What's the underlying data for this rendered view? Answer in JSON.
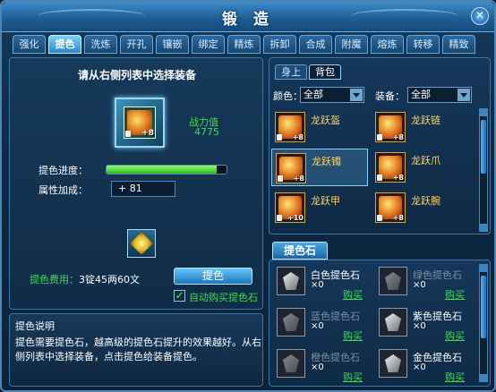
{
  "window": {
    "title": "锻 造",
    "close_icon": "close-icon"
  },
  "tabs": [
    "强化",
    "提色",
    "洗炼",
    "开孔",
    "镶嵌",
    "绑定",
    "精炼",
    "拆卸",
    "合成",
    "附魔",
    "熔炼",
    "转移",
    "精致"
  ],
  "active_tab": "提色",
  "left": {
    "instruction": "请从右侧列表中选择装备",
    "selected_item": {
      "plus": "+8"
    },
    "power_label": "战力值",
    "power_value": "4775",
    "progress_label": "提色进度：",
    "progress_fraction": 0.92,
    "attr_label": "属性加成：",
    "attr_value": "+ 81",
    "cost_label": "提色费用：",
    "cost_value": "3锭45两60文",
    "refine_button": "提色",
    "auto_buy_checked": true,
    "auto_buy_label": "自动购买提色石"
  },
  "description": {
    "title": "提色说明",
    "text": "提色需要提色石，越高级的提色石提升的效果越好。从右侧列表中选择装备，点击提色给装备提色。"
  },
  "right": {
    "subtabs": [
      "身上",
      "背包"
    ],
    "active_subtab": "背包",
    "color_label": "颜色：",
    "color_value": "全部",
    "equip_label": "装备：",
    "equip_value": "全部",
    "items": [
      {
        "name": "龙跃盔",
        "plus": "+8"
      },
      {
        "name": "龙跃链",
        "plus": "+8"
      },
      {
        "name": "龙跃镯",
        "plus": "+8"
      },
      {
        "name": "龙跃爪",
        "plus": "+8"
      },
      {
        "name": "龙跃甲",
        "plus": "+10"
      },
      {
        "name": "龙跃腕",
        "plus": "+8"
      }
    ]
  },
  "stones": {
    "header": "提色石",
    "items": [
      {
        "name": "白色提色石",
        "count": "×0",
        "buy": "购买",
        "dim": false
      },
      {
        "name": "绿色提色石",
        "count": "×0",
        "buy": "购买",
        "dim": true
      },
      {
        "name": "蓝色提色石",
        "count": "×0",
        "buy": "购买",
        "dim": true
      },
      {
        "name": "紫色提色石",
        "count": "×0",
        "buy": "购买",
        "dim": false
      },
      {
        "name": "橙色提色石",
        "count": "×0",
        "buy": "购买",
        "dim": true
      },
      {
        "name": "金色提色石",
        "count": "×0",
        "buy": "购买",
        "dim": false
      }
    ]
  }
}
